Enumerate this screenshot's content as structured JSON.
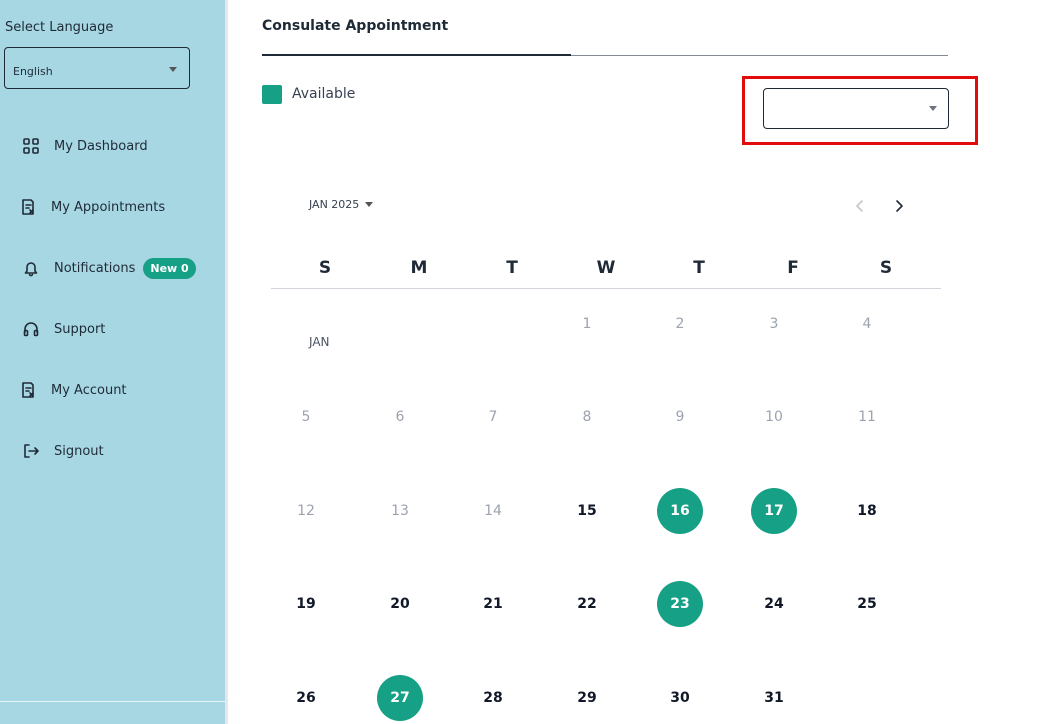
{
  "sidebar": {
    "language_label": "Select Language",
    "language_value": "English",
    "items": [
      {
        "label": "My Dashboard",
        "icon": "dashboard-icon"
      },
      {
        "label": "My Appointments",
        "icon": "appointments-icon"
      },
      {
        "label": "Notifications",
        "icon": "bell-icon",
        "badge": "New 0"
      },
      {
        "label": "Support",
        "icon": "headset-icon"
      },
      {
        "label": "My Account",
        "icon": "account-icon"
      },
      {
        "label": "Signout",
        "icon": "signout-icon"
      }
    ]
  },
  "main": {
    "tab_title": "Consulate Appointment",
    "legend": {
      "label": "Available",
      "color": "#16a085"
    },
    "consulate_select": {
      "value": ""
    },
    "highlight_color": "#e10d0d"
  },
  "calendar": {
    "month_label": "JAN 2025",
    "month_tag": "JAN",
    "weekdays": [
      "S",
      "M",
      "T",
      "W",
      "T",
      "F",
      "S"
    ],
    "days": [
      {
        "d": "1",
        "state": "past"
      },
      {
        "d": "2",
        "state": "past"
      },
      {
        "d": "3",
        "state": "past"
      },
      {
        "d": "4",
        "state": "past"
      },
      {
        "d": "5",
        "state": "past"
      },
      {
        "d": "6",
        "state": "past"
      },
      {
        "d": "7",
        "state": "past"
      },
      {
        "d": "8",
        "state": "past"
      },
      {
        "d": "9",
        "state": "past"
      },
      {
        "d": "10",
        "state": "past"
      },
      {
        "d": "11",
        "state": "past"
      },
      {
        "d": "12",
        "state": "past"
      },
      {
        "d": "13",
        "state": "past"
      },
      {
        "d": "14",
        "state": "past"
      },
      {
        "d": "15",
        "state": "future"
      },
      {
        "d": "16",
        "state": "available"
      },
      {
        "d": "17",
        "state": "available"
      },
      {
        "d": "18",
        "state": "future"
      },
      {
        "d": "19",
        "state": "future"
      },
      {
        "d": "20",
        "state": "future"
      },
      {
        "d": "21",
        "state": "future"
      },
      {
        "d": "22",
        "state": "future"
      },
      {
        "d": "23",
        "state": "available"
      },
      {
        "d": "24",
        "state": "future"
      },
      {
        "d": "25",
        "state": "future"
      },
      {
        "d": "26",
        "state": "future"
      },
      {
        "d": "27",
        "state": "available"
      },
      {
        "d": "28",
        "state": "future"
      },
      {
        "d": "29",
        "state": "future"
      },
      {
        "d": "30",
        "state": "future"
      },
      {
        "d": "31",
        "state": "future"
      }
    ]
  }
}
